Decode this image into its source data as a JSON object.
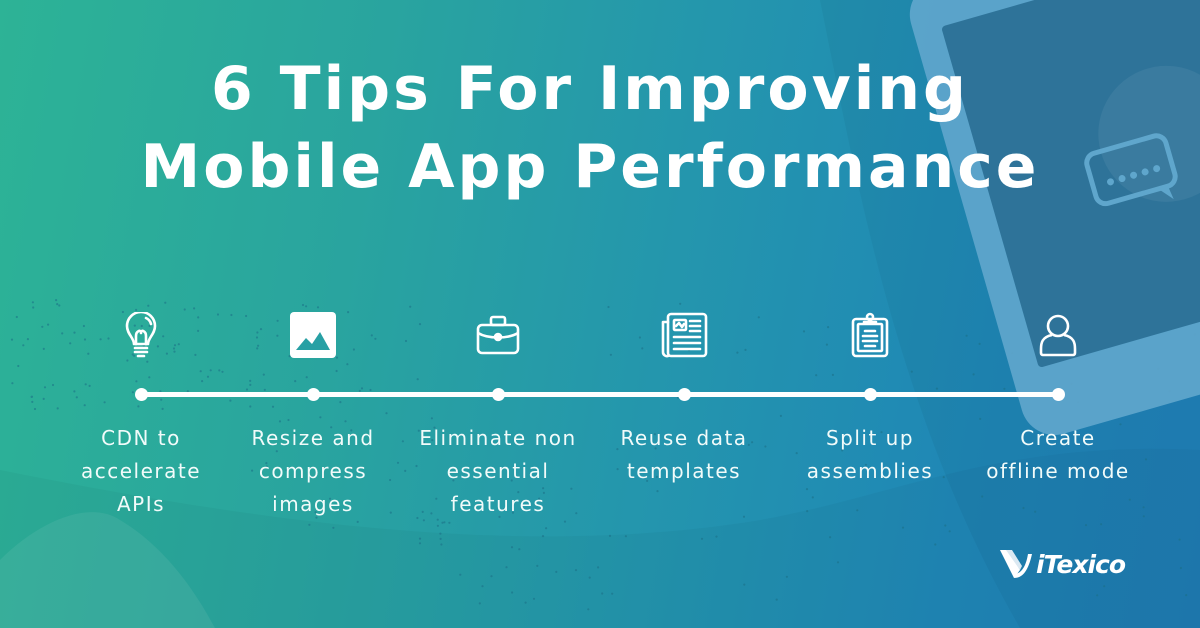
{
  "title": {
    "line1": "6 Tips For Improving",
    "line2": "Mobile App Performance"
  },
  "colors": {
    "gradient_start": "#2db396",
    "gradient_end": "#207fb8",
    "phone_body": "#5fa6cc",
    "phone_screen": "#2e7399",
    "text": "#ffffff"
  },
  "timeline": {
    "steps": [
      {
        "icon": "lightbulb-icon",
        "label": "CDN to\naccelerate\nAPIs"
      },
      {
        "icon": "image-icon",
        "label": "Resize and\ncompress\nimages"
      },
      {
        "icon": "briefcase-icon",
        "label": "Eliminate non\nessential\nfeatures"
      },
      {
        "icon": "newspaper-icon",
        "label": "Reuse data\ntemplates"
      },
      {
        "icon": "clipboard-icon",
        "label": "Split up\nassemblies"
      },
      {
        "icon": "user-icon",
        "label": "Create\noffline mode"
      }
    ]
  },
  "logo": {
    "text": "iTexico"
  },
  "decor": {
    "phone_icon": "smartphone-icon",
    "chat_icon": "chat-bubble-icon"
  }
}
